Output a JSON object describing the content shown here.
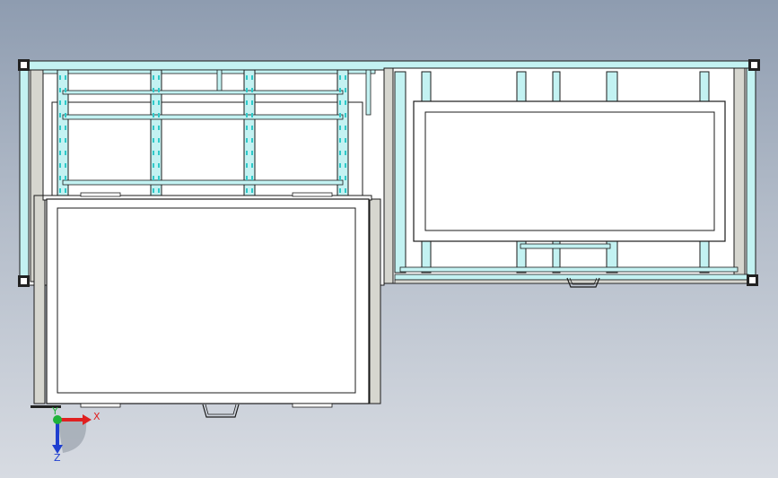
{
  "viewport": {
    "background_top": "#8e9cb0",
    "background_bottom": "#d7dbe2"
  },
  "colors": {
    "frame_profile": "#c3f2f2",
    "frame_profile_dark": "#2fc9c9",
    "frame_outline": "#1b1b1b",
    "panel_fill": "#ffffff",
    "side_panel_fill": "#d6d6cf",
    "corner_block": "#222222",
    "axis_x": "#e02020",
    "axis_y": "#1fb23a",
    "axis_z": "#1f3fd0"
  },
  "triad": {
    "x_label": "X",
    "y_label": "Y",
    "z_label": "Z"
  }
}
